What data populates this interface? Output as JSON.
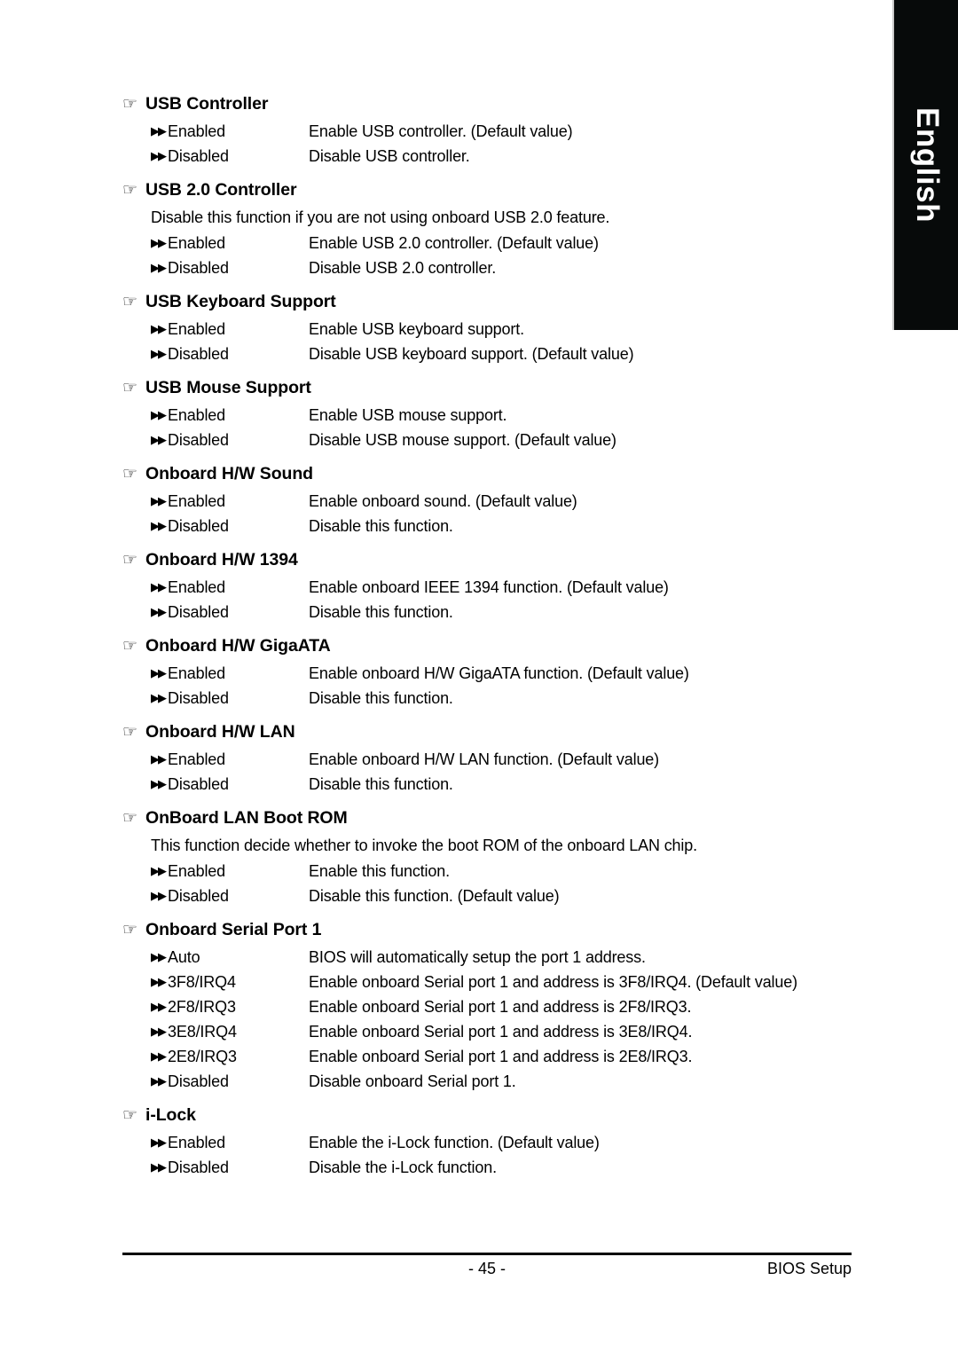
{
  "language_tab": {
    "label": "English"
  },
  "markers": {
    "section_icon": "☞",
    "option_icon": "▶▶"
  },
  "sections": [
    {
      "title": "USB Controller",
      "note": null,
      "options": [
        {
          "name": "Enabled",
          "desc": "Enable USB controller. (Default value)"
        },
        {
          "name": "Disabled",
          "desc": "Disable USB controller."
        }
      ]
    },
    {
      "title": "USB 2.0 Controller",
      "note": "Disable this function if you are not using onboard USB 2.0 feature.",
      "options": [
        {
          "name": "Enabled",
          "desc": "Enable USB 2.0 controller. (Default value)"
        },
        {
          "name": "Disabled",
          "desc": "Disable USB 2.0 controller."
        }
      ]
    },
    {
      "title": "USB Keyboard Support",
      "note": null,
      "options": [
        {
          "name": "Enabled",
          "desc": "Enable USB keyboard support."
        },
        {
          "name": "Disabled",
          "desc": "Disable USB keyboard support. (Default value)"
        }
      ]
    },
    {
      "title": "USB Mouse Support",
      "note": null,
      "options": [
        {
          "name": "Enabled",
          "desc": "Enable USB mouse support."
        },
        {
          "name": "Disabled",
          "desc": "Disable USB mouse support. (Default value)"
        }
      ]
    },
    {
      "title": "Onboard H/W Sound",
      "note": null,
      "options": [
        {
          "name": "Enabled",
          "desc": "Enable onboard sound. (Default value)"
        },
        {
          "name": "Disabled",
          "desc": "Disable this function."
        }
      ]
    },
    {
      "title": "Onboard H/W 1394",
      "note": null,
      "options": [
        {
          "name": "Enabled",
          "desc": "Enable onboard IEEE 1394 function. (Default value)"
        },
        {
          "name": "Disabled",
          "desc": "Disable this function."
        }
      ]
    },
    {
      "title": "Onboard H/W GigaATA",
      "note": null,
      "options": [
        {
          "name": "Enabled",
          "desc": "Enable onboard H/W GigaATA function. (Default value)"
        },
        {
          "name": "Disabled",
          "desc": "Disable this function."
        }
      ]
    },
    {
      "title": "Onboard H/W LAN",
      "note": null,
      "options": [
        {
          "name": "Enabled",
          "desc": "Enable onboard H/W LAN function. (Default value)"
        },
        {
          "name": "Disabled",
          "desc": "Disable this function."
        }
      ]
    },
    {
      "title": "OnBoard LAN Boot ROM",
      "note": "This function decide whether to invoke the boot ROM of the onboard LAN chip.",
      "options": [
        {
          "name": "Enabled",
          "desc": "Enable this function."
        },
        {
          "name": "Disabled",
          "desc": "Disable this function. (Default value)"
        }
      ]
    },
    {
      "title": "Onboard Serial Port 1",
      "note": null,
      "options": [
        {
          "name": "Auto",
          "desc": "BIOS will automatically setup the port 1 address."
        },
        {
          "name": "3F8/IRQ4",
          "desc": "Enable onboard Serial port 1 and address is 3F8/IRQ4. (Default value)"
        },
        {
          "name": "2F8/IRQ3",
          "desc": "Enable onboard Serial port 1 and address is 2F8/IRQ3."
        },
        {
          "name": "3E8/IRQ4",
          "desc": "Enable onboard Serial port 1 and address is 3E8/IRQ4."
        },
        {
          "name": "2E8/IRQ3",
          "desc": "Enable onboard Serial port 1 and address is 2E8/IRQ3."
        },
        {
          "name": "Disabled",
          "desc": "Disable onboard Serial port 1."
        }
      ]
    },
    {
      "title": "i-Lock",
      "note": null,
      "options": [
        {
          "name": "Enabled",
          "desc": "Enable the i-Lock function. (Default value)"
        },
        {
          "name": "Disabled",
          "desc": "Disable the i-Lock function."
        }
      ]
    }
  ],
  "footer": {
    "page_number": "- 45 -",
    "section_label": "BIOS Setup"
  }
}
